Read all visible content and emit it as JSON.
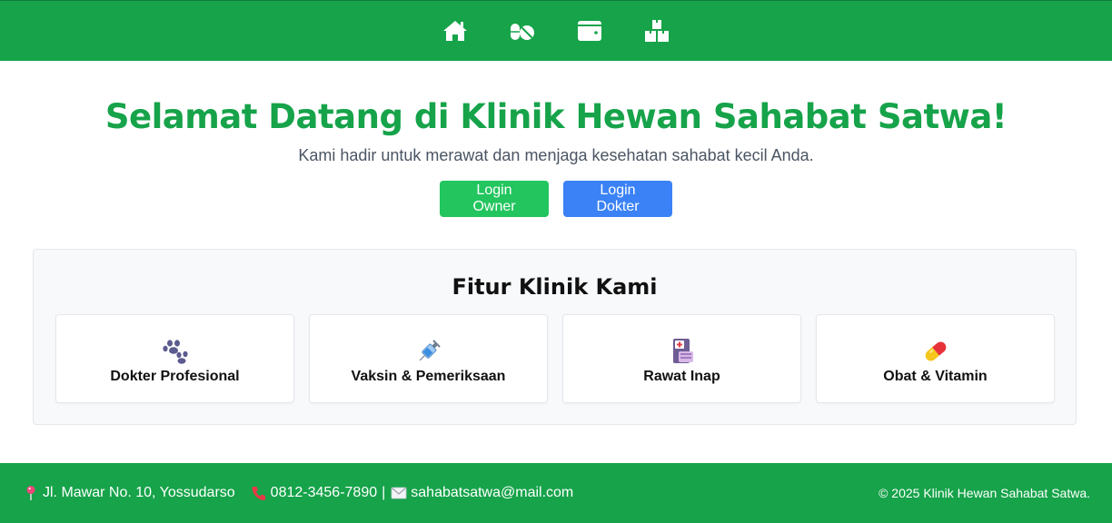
{
  "nav": {
    "items": [
      {
        "icon": "home-icon"
      },
      {
        "icon": "pills-icon"
      },
      {
        "icon": "wallet-icon"
      },
      {
        "icon": "boxes-icon"
      }
    ]
  },
  "hero": {
    "title": "Selamat Datang di Klinik Hewan Sahabat Satwa!",
    "subtitle": "Kami hadir untuk merawat dan menjaga kesehatan sahabat kecil Anda.",
    "login_owner_label": "Login Owner",
    "login_dokter_label": "Login Dokter"
  },
  "features": {
    "title": "Fitur Klinik Kami",
    "items": [
      {
        "icon": "paw-icon",
        "label": "Dokter Profesional"
      },
      {
        "icon": "syringe-icon",
        "label": "Vaksin & Pemeriksaan"
      },
      {
        "icon": "hospital-bed-icon",
        "label": "Rawat Inap"
      },
      {
        "icon": "pill-icon",
        "label": "Obat & Vitamin"
      }
    ]
  },
  "footer": {
    "address": "Jl. Mawar No. 10, Yossudarso",
    "phone": "0812-3456-7890",
    "separator": "|",
    "email": "sahabatsatwa@mail.com",
    "copyright": "© 2025 Klinik Hewan Sahabat Satwa."
  },
  "colors": {
    "primary_green": "#16a34a",
    "owner_button": "#22c55e",
    "dokter_button": "#3b82f6"
  }
}
